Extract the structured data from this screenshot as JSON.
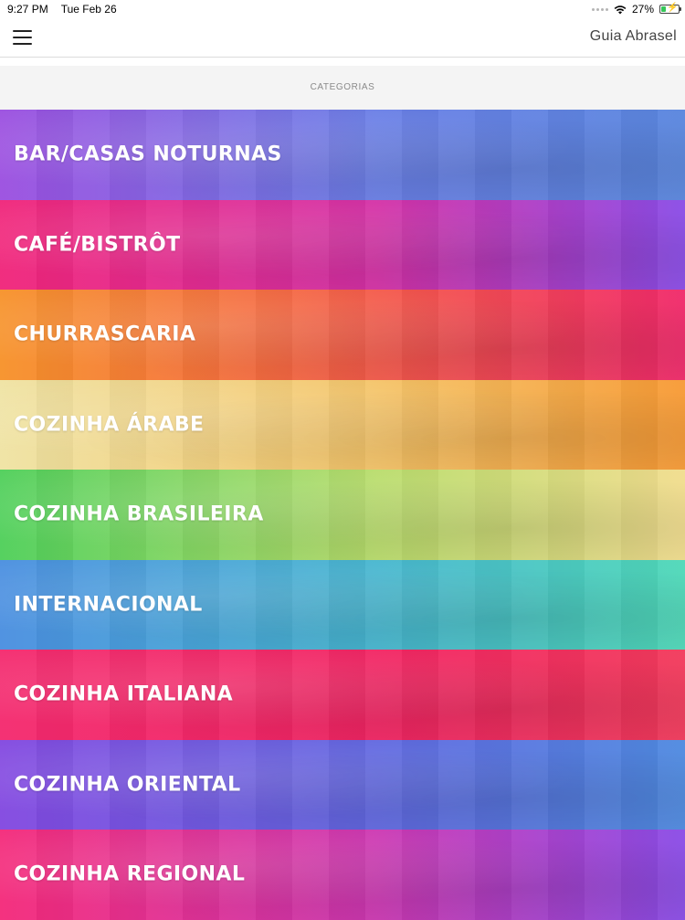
{
  "status": {
    "time": "9:27 PM",
    "date": "Tue Feb 26",
    "battery": "27%",
    "battery_level": 0.27
  },
  "nav": {
    "title": "Guia Abrasel",
    "menu_icon": "hamburger-menu-icon"
  },
  "header": {
    "label": "CATEGORIAS"
  },
  "categories": [
    {
      "label": "BAR/CASAS NOTURNAS",
      "colors": [
        "#9b4fe0",
        "#6a7fe6",
        "#5a86de"
      ]
    },
    {
      "label": "CAFÉ/BISTRÔT",
      "colors": [
        "#f0257a",
        "#d431a6",
        "#8a4ce6"
      ]
    },
    {
      "label": "CHURRASCARIA",
      "colors": [
        "#f7922a",
        "#f45a4a",
        "#f02a6a"
      ]
    },
    {
      "label": "COZINHA ÁRABE",
      "colors": [
        "#efe3a3",
        "#f5c468",
        "#f79a35"
      ]
    },
    {
      "label": "COZINHA BRASILEIRA",
      "colors": [
        "#4fcf5a",
        "#b9dd6c",
        "#f1dd8e"
      ]
    },
    {
      "label": "INTERNACIONAL",
      "colors": [
        "#4a8fe0",
        "#47b6cf",
        "#4fd8b8"
      ]
    },
    {
      "label": "COZINHA ITALIANA",
      "colors": [
        "#f42a6e",
        "#f12563",
        "#f23a5c"
      ]
    },
    {
      "label": "COZINHA ORIENTAL",
      "colors": [
        "#8248e0",
        "#6168e0",
        "#4f8ae0"
      ]
    },
    {
      "label": "COZINHA REGIONAL",
      "colors": [
        "#f42a7a",
        "#cc38b2",
        "#8a4ce6"
      ]
    }
  ]
}
